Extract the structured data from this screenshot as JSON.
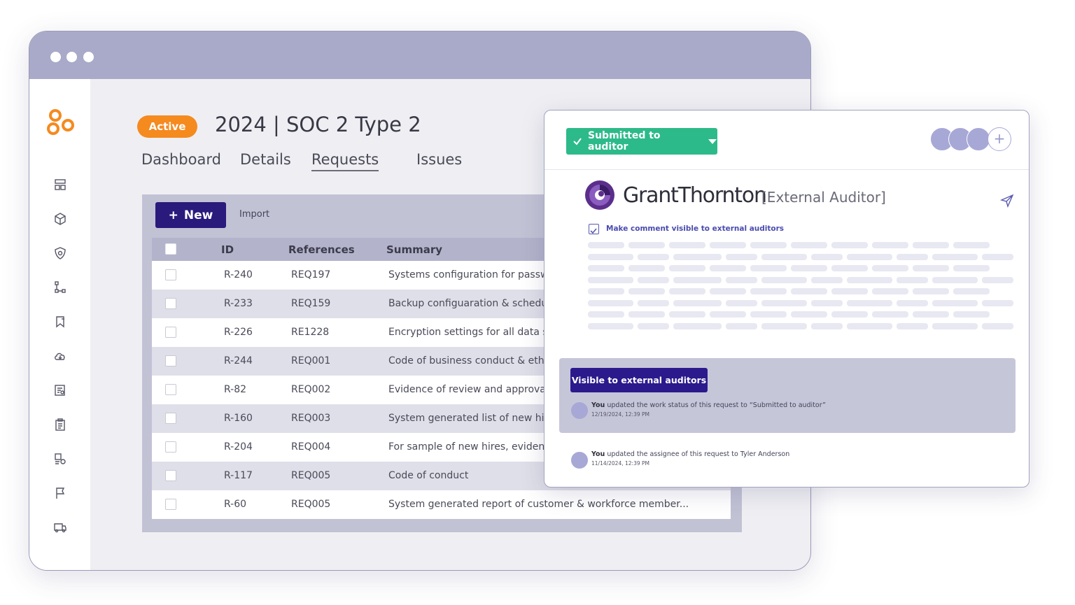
{
  "window": {
    "tabs": [
      {
        "label": "Dashboard"
      },
      {
        "label": "Details"
      },
      {
        "label": "Requests"
      },
      {
        "label": "Issues"
      }
    ]
  },
  "header": {
    "status_badge": "Active",
    "title": "2024 | SOC 2 Type 2"
  },
  "toolbar": {
    "new_label": "New",
    "new_icon": "+",
    "import_label": "Import"
  },
  "table": {
    "columns": [
      "ID",
      "References",
      "Summary"
    ],
    "rows": [
      {
        "id": "R-240",
        "ref": "REQ197",
        "summary": "Systems configuration for password requirements"
      },
      {
        "id": "R-233",
        "ref": "REQ159",
        "summary": "Backup configuaration & schedule"
      },
      {
        "id": "R-226",
        "ref": "RE1228",
        "summary": "Encryption settings for all data stores"
      },
      {
        "id": "R-244",
        "ref": "REQ001",
        "summary": "Code of business conduct & ethics"
      },
      {
        "id": "R-82",
        "ref": "REQ002",
        "summary": "Evidence of review and approval"
      },
      {
        "id": "R-160",
        "ref": "REQ003",
        "summary": "System generated list of new hires"
      },
      {
        "id": "R-204",
        "ref": "REQ004",
        "summary": "For sample of new hires, evidence"
      },
      {
        "id": "R-117",
        "ref": "REQ005",
        "summary": "Code of conduct"
      },
      {
        "id": "R-60",
        "ref": "REQ005",
        "summary": "System generated report of customer & workforce member..."
      }
    ]
  },
  "card": {
    "status_label": "Submitted to auditor",
    "auditor_name": "GrantThornton",
    "auditor_role": "[External Auditor]",
    "visibility_label": "Make comment visible to external auditors",
    "visible_button": "Visible to external auditors",
    "activity": [
      {
        "actor": "You",
        "text": " updated the work status of this request to “Submitted to auditor”",
        "time": "12/19/2024, 12:39 PM"
      },
      {
        "actor": "You",
        "text": " updated the assignee of this request to Tyler Anderson",
        "time": "11/14/2024, 12:39 PM"
      }
    ]
  },
  "colors": {
    "active_badge": "#f58a1f",
    "primary_button": "#2a1a7c",
    "status_green": "#2dba8a",
    "titlebar": "#a9a9c9",
    "logo_orange": "#f58a1f",
    "gt_purple": "#4f2d7f"
  },
  "icons": {
    "sidebar": [
      "layout-icon",
      "package-icon",
      "shield-icon",
      "workflow-icon",
      "bookmark-icon",
      "cloud-icon",
      "report-icon",
      "clipboard-icon",
      "tasks-icon",
      "flag-icon",
      "truck-icon"
    ],
    "card": [
      "check-icon",
      "caret-down-icon",
      "plus-icon",
      "send-icon"
    ]
  }
}
